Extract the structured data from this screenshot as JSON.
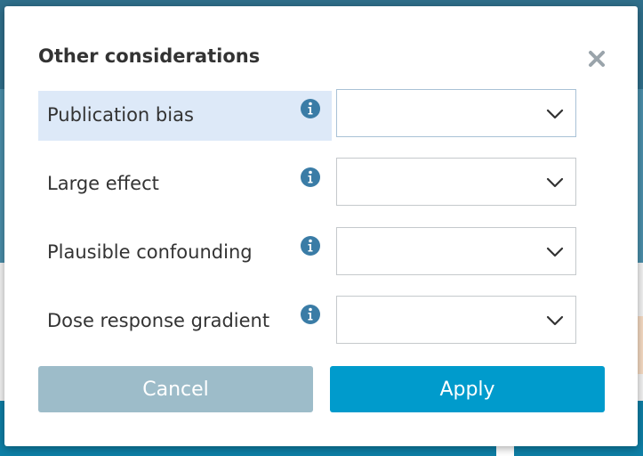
{
  "dialog": {
    "title": "Other considerations",
    "fields": [
      {
        "label": "Publication bias",
        "value": ""
      },
      {
        "label": "Large effect",
        "value": ""
      },
      {
        "label": "Plausible confounding",
        "value": ""
      },
      {
        "label": "Dose response gradient",
        "value": ""
      }
    ],
    "cancel_label": "Cancel",
    "apply_label": "Apply"
  },
  "colors": {
    "accent": "#009bcc",
    "cancel": "#9dbcc9",
    "info_icon": "#3a7ca6",
    "active_row": "#dde9f8"
  },
  "icons": {
    "close": "close-icon",
    "info": "info-icon",
    "dropdown": "chevron-down-icon"
  }
}
